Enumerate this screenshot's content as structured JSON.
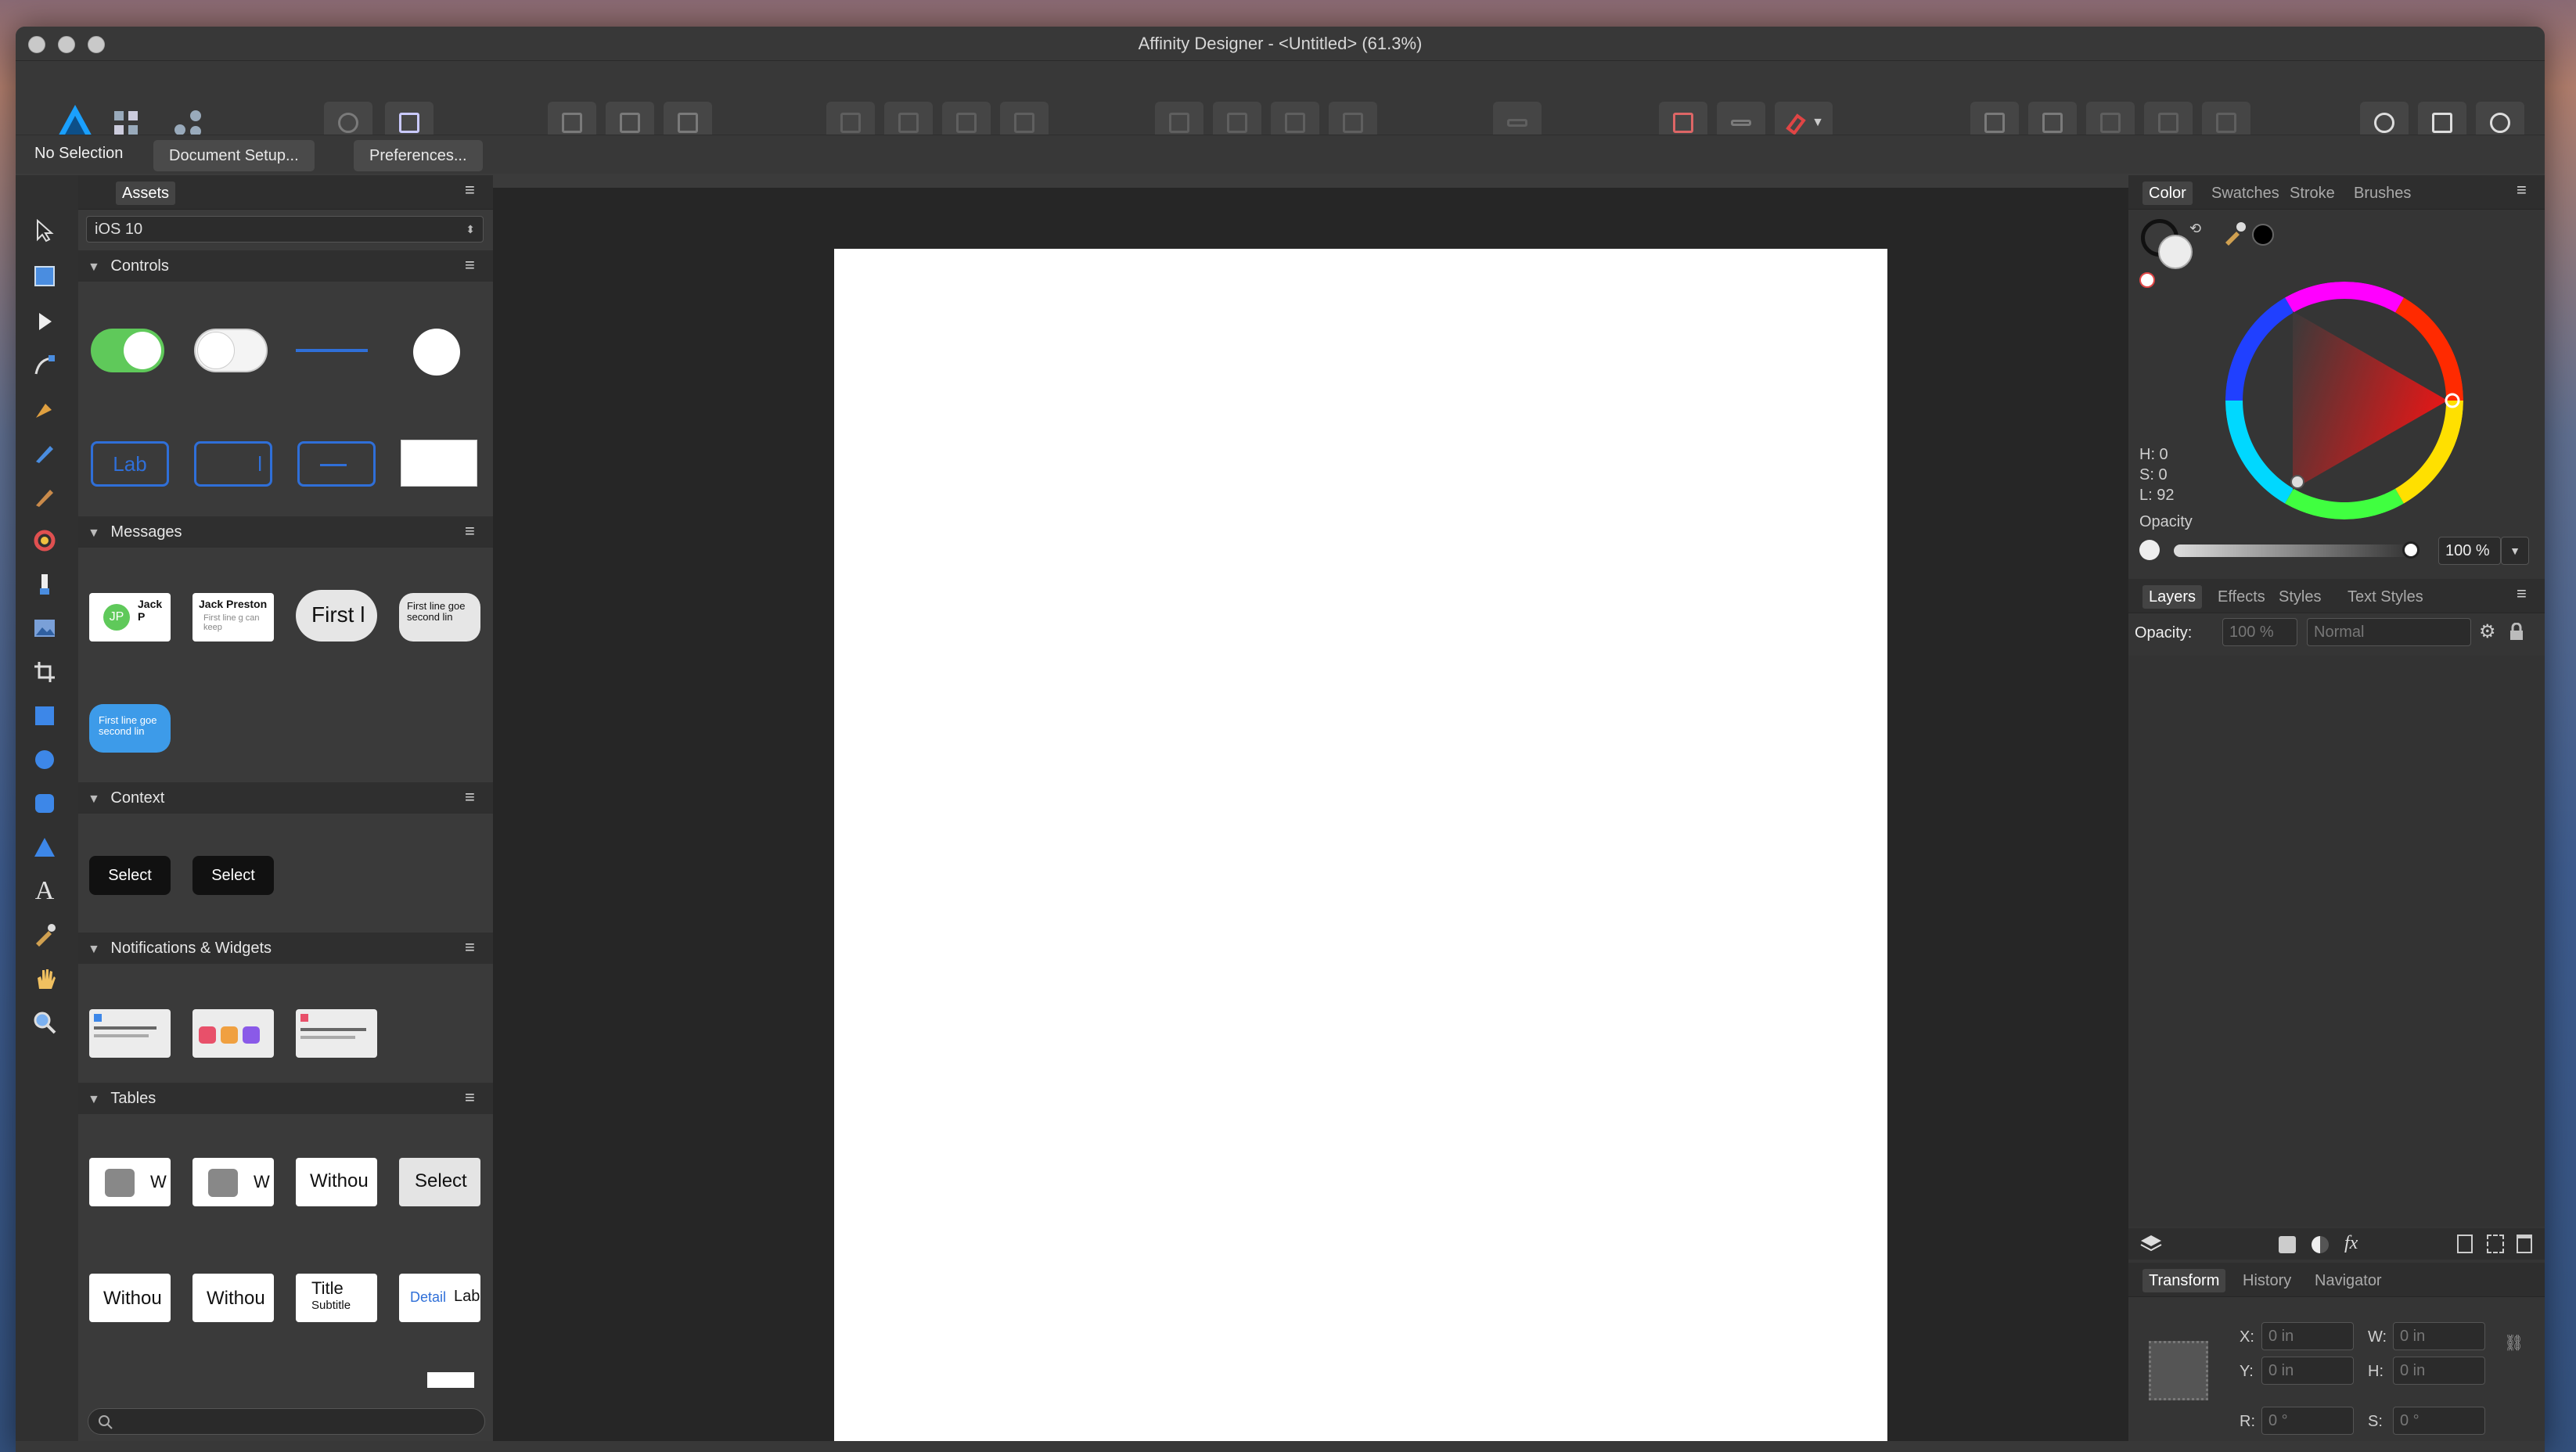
{
  "window": {
    "title": "Affinity Designer - <Untitled> (61.3%)"
  },
  "context_bar": {
    "selection": "No Selection",
    "document_setup": "Document Setup...",
    "preferences": "Preferences..."
  },
  "assets_panel": {
    "tab": "Assets",
    "library": "iOS 10",
    "sections": {
      "controls": "Controls",
      "messages": "Messages",
      "context": "Context",
      "notifications": "Notifications & Widgets",
      "tables": "Tables"
    },
    "thumbs": {
      "lab1": "Lab",
      "lab2": "l",
      "msg1": "Jack P",
      "msg2": "Jack Preston",
      "msg2b": "First line g can keep",
      "msg3": "First l",
      "msg4": "First line goe second lin",
      "msg5": "First line goe second lin",
      "ctx1": "Select",
      "ctx2": "Select",
      "t1": "W",
      "t2": "W",
      "t3": "Withou",
      "t4": "Select",
      "t5": "Withou",
      "t6": "Withou",
      "t7a": "Title",
      "t7b": "Subtitle",
      "t8a": "Detail",
      "t8b": "Lab"
    }
  },
  "color_panel": {
    "tabs": [
      "Color",
      "Swatches",
      "Stroke",
      "Brushes"
    ],
    "h": "H: 0",
    "s": "S: 0",
    "l": "L: 92",
    "opacity_label": "Opacity",
    "opacity_value": "100 %"
  },
  "layers_panel": {
    "tabs": [
      "Layers",
      "Effects",
      "Styles",
      "Text Styles"
    ],
    "opacity_label": "Opacity:",
    "opacity_value": "100 %",
    "blend_mode": "Normal"
  },
  "transform_panel": {
    "tabs": [
      "Transform",
      "History",
      "Navigator"
    ],
    "x_label": "X:",
    "x_value": "0 in",
    "y_label": "Y:",
    "y_value": "0 in",
    "w_label": "W:",
    "w_value": "0 in",
    "h_label": "H:",
    "h_value": "0 in",
    "r_label": "R:",
    "r_value": "0 °",
    "s_label": "S:",
    "s_value": "0 °"
  },
  "colors": {
    "accent_green": "#5fc95a",
    "accent_blue": "#2f6fd8",
    "ui_dark": "#383838"
  }
}
